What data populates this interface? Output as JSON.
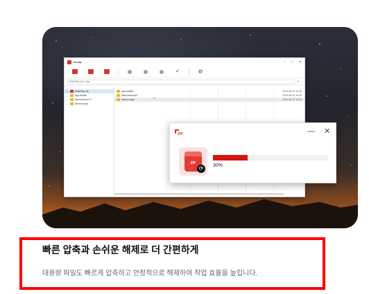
{
  "app": {
    "name": "ez-zip",
    "window_controls": [
      "–",
      "□",
      "✕"
    ]
  },
  "toolbar": {
    "icons": [
      "zip-new-icon",
      "zip-save-icon",
      "zip-pdf-icon",
      "zip-extract-icon",
      "zip-extract-here-icon",
      "zip-test-icon",
      "check-icon",
      "gear-icon"
    ]
  },
  "address": {
    "path": "MakeTop.zip > app",
    "search_icon": "search-icon"
  },
  "tree": {
    "items": [
      {
        "label": "MakeTop.zip",
        "type": "zip",
        "selected": true
      },
      {
        "label": "app-builder",
        "type": "folder",
        "selected": false
      },
      {
        "label": "MacCommon 3",
        "type": "folder",
        "selected": false
      },
      {
        "label": "window-app",
        "type": "folder",
        "selected": false
      }
    ]
  },
  "files": {
    "rows": [
      {
        "name": "app-builder",
        "date": "2024-06-20 10:26",
        "selected": false
      },
      {
        "name": "MacCommon4",
        "date": "2024-06-20 14:26",
        "selected": false
      },
      {
        "name": "window-app",
        "date": "2024-06-20 10:26",
        "selected": true
      }
    ]
  },
  "dialog": {
    "logo_text": "ZIP",
    "minimize": "—",
    "close": "✕",
    "tile_label": "ZIP",
    "progress_percent": 30,
    "progress_text": "30%"
  },
  "colors": {
    "accent": "#d8140f",
    "highlight_border": "#ff0000"
  },
  "caption": {
    "heading": "빠른 압축과 손쉬운 해제로 더 간편하게",
    "description": "대용량 파일도 빠르게 압축하고 안정적으로 해제하여 작업 효율을 높입니다."
  }
}
